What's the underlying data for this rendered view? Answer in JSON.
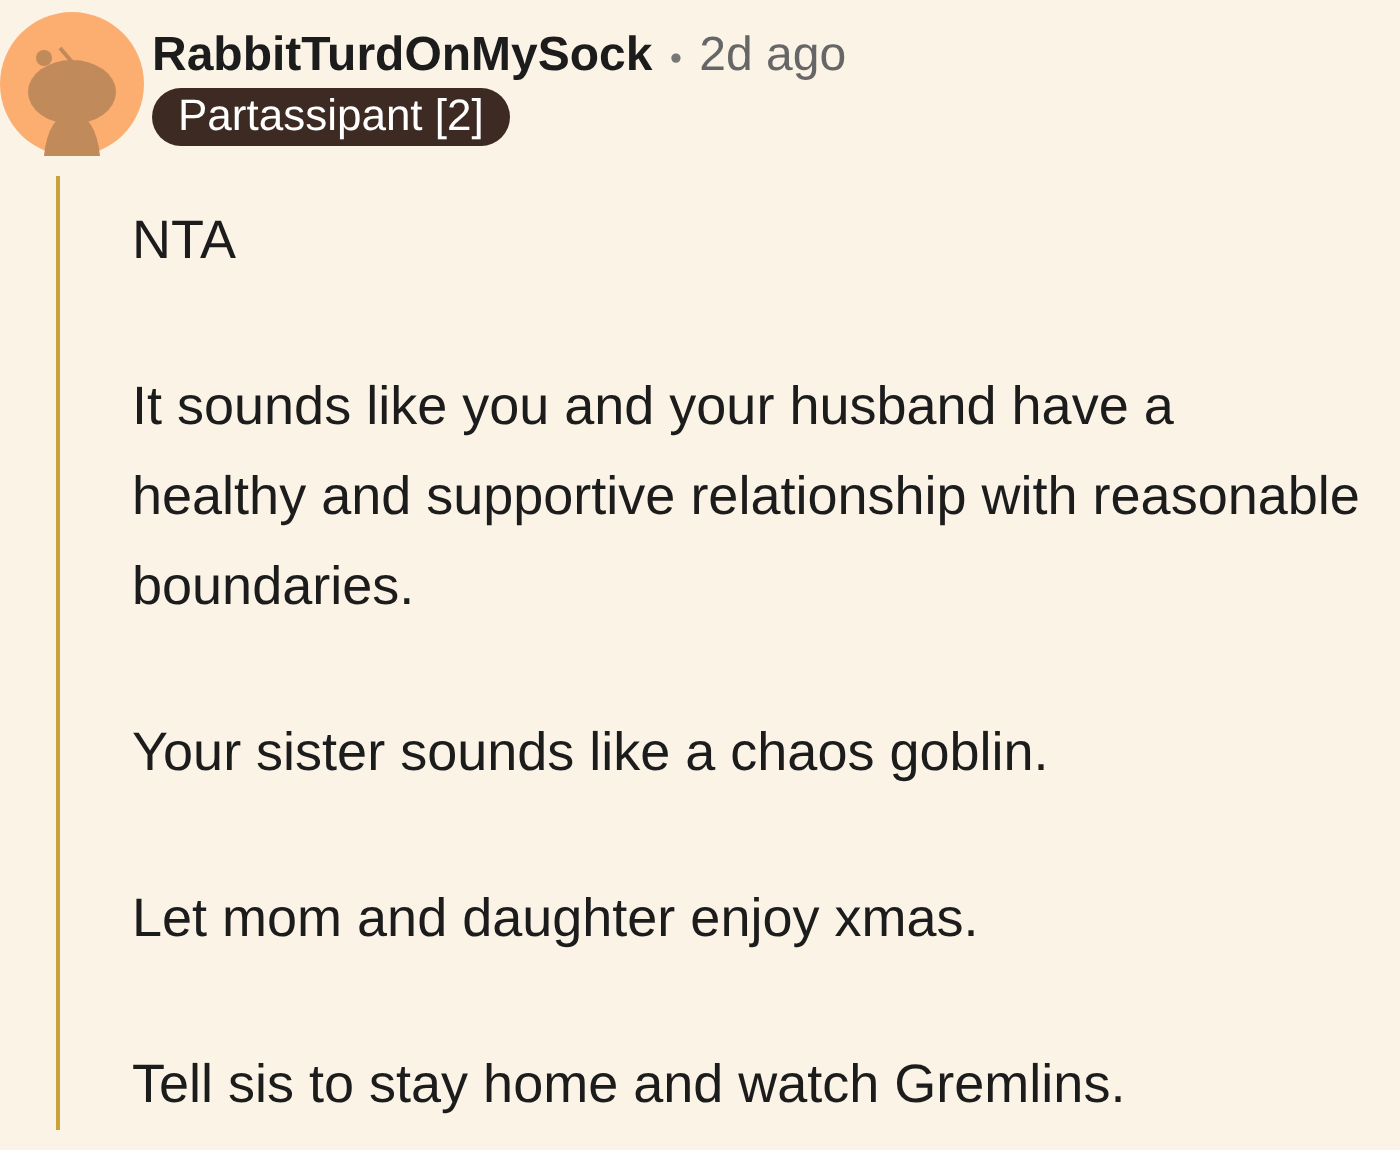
{
  "comment": {
    "author": "RabbitTurdOnMySock",
    "separator": "•",
    "time": "2d ago",
    "flair": "Partassipant [2]",
    "paragraphs": [
      "NTA",
      "It sounds like you and your husband have a healthy and supportive relationship with reasonable boundaries.",
      "Your sister sounds like a chaos goblin.",
      "Let mom and daughter enjoy xmas.",
      "Tell sis to stay home and watch Gremlins."
    ]
  }
}
